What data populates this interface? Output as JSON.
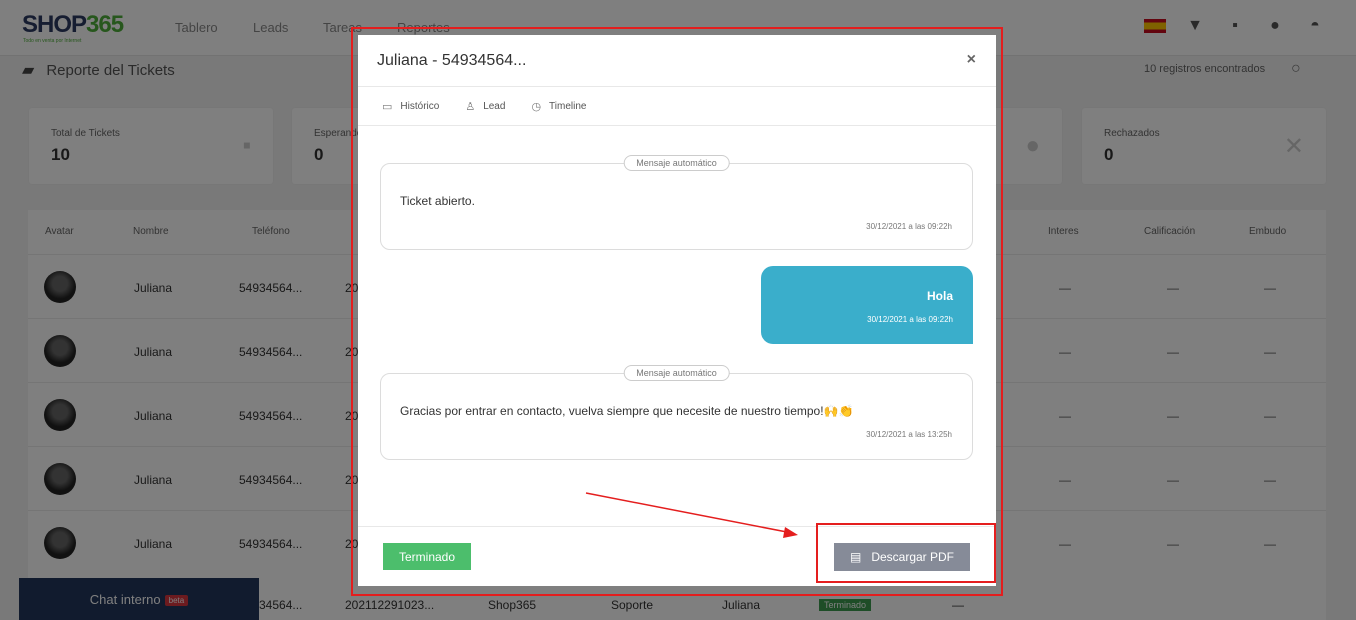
{
  "header": {
    "logo_main": "SHOP",
    "logo_num": "365",
    "logo_tagline": "Todo en venta por Internet",
    "nav": [
      "Tablero",
      "Leads",
      "Tareas",
      "Reportes"
    ]
  },
  "page": {
    "title": "Reporte del Tickets",
    "records": "10 registros encontrados"
  },
  "cards": [
    {
      "label": "Total de Tickets",
      "value": "10"
    },
    {
      "label": "Esperando",
      "value": "0"
    },
    {
      "label": "Rechazados",
      "value": "0"
    }
  ],
  "table": {
    "headers": [
      "Avatar",
      "Nombre",
      "Teléfono",
      "Interes",
      "Calificación",
      "Embudo"
    ],
    "rows": [
      {
        "name": "Juliana",
        "phone": "54934564...",
        "id": "20",
        "dash": "—"
      },
      {
        "name": "Juliana",
        "phone": "54934564...",
        "id": "20",
        "dash": "—"
      },
      {
        "name": "Juliana",
        "phone": "54934564...",
        "id": "20",
        "dash": "—"
      },
      {
        "name": "Juliana",
        "phone": "54934564...",
        "id": "20",
        "dash": "—"
      },
      {
        "name": "Juliana",
        "phone": "54934564...",
        "id": "20",
        "dash": "—"
      }
    ],
    "bottom_row": {
      "phone": "34564...",
      "id": "202112291023...",
      "company": "Shop365",
      "area": "Soporte",
      "agent": "Juliana",
      "status": "Terminado",
      "dash": "—"
    }
  },
  "chat_tab": {
    "label": "Chat interno",
    "badge": "beta"
  },
  "modal": {
    "title": "Juliana - 54934564...",
    "close": "×",
    "tabs": [
      {
        "label": "Histórico"
      },
      {
        "label": "Lead"
      },
      {
        "label": "Timeline"
      }
    ],
    "messages": [
      {
        "type": "auto",
        "label": "Mensaje automático",
        "text": "Ticket abierto.",
        "time": "30/12/2021 a las 09:22h"
      },
      {
        "type": "out",
        "text": "Hola",
        "time": "30/12/2021 a las 09:22h"
      },
      {
        "type": "auto",
        "label": "Mensaje automático",
        "text": "Gracias por entrar en contacto, vuelva siempre que necesite de nuestro tiempo!🙌👏",
        "time": "30/12/2021 a las 13:25h"
      }
    ],
    "footer": {
      "status_button": "Terminado",
      "pdf_button": "Descargar PDF"
    }
  },
  "colors": {
    "accent_blue": "#3aaecb",
    "success_green": "#4cbe6c",
    "pdf_gray": "#868b98",
    "annotation_red": "#e41e1e",
    "brand_navy": "#23365c"
  }
}
